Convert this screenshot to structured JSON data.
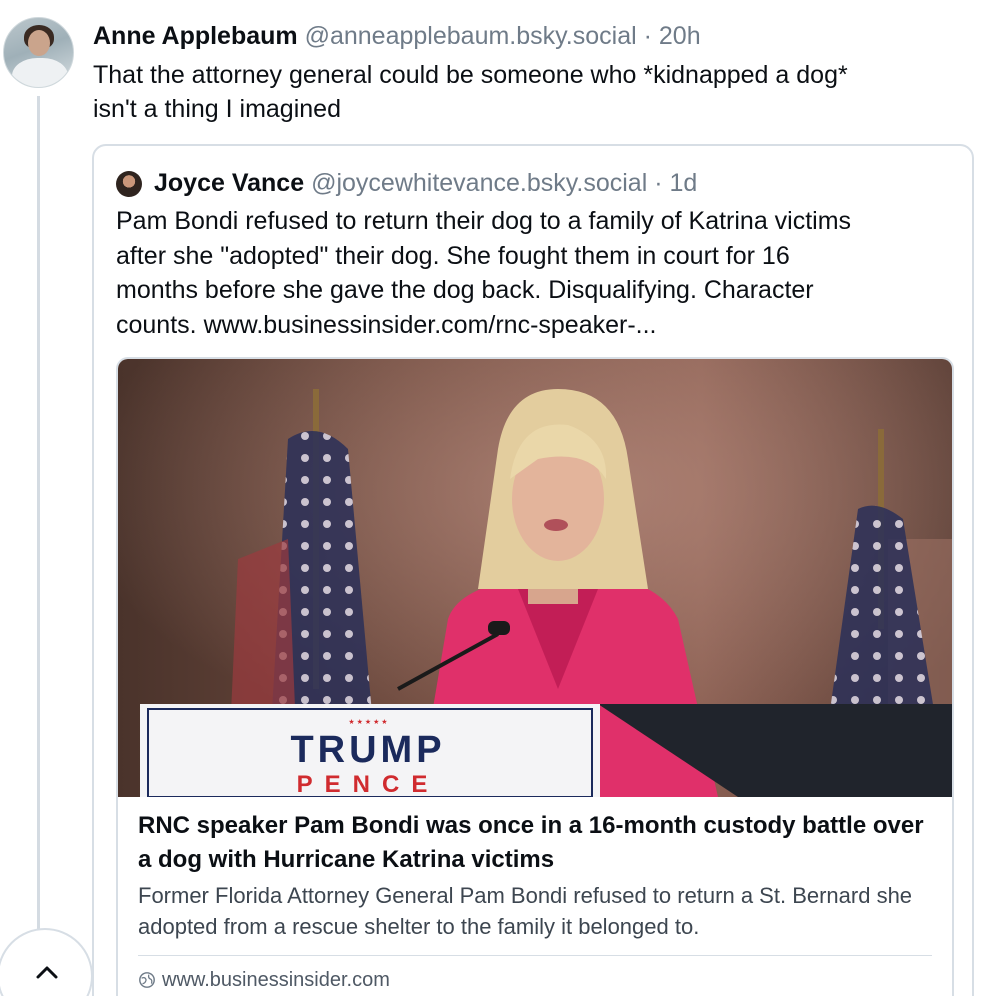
{
  "post": {
    "author": "Anne Applebaum",
    "handle": "@anneapplebaum.bsky.social",
    "separator": "·",
    "time": "20h",
    "text": "That the attorney general could be someone who *kidnapped a dog*\nisn't a thing I imagined"
  },
  "quote": {
    "author": "Joyce Vance",
    "handle": "@joycewhitevance.bsky.social",
    "separator": "·",
    "time": "1d",
    "text": "Pam Bondi refused to return their dog to a family of Katrina victims\nafter she \"adopted\" their dog. She fought them in court for 16\nmonths before she gave the dog back. Disqualifying. Character\ncounts.   ",
    "link_text": "www.businessinsider.com/rnc-speaker-..."
  },
  "embed": {
    "podium_line1": "TRUMP",
    "podium_line2": "PENCE",
    "podium_stars": "★ ★ ★ ★ ★",
    "title": "RNC speaker Pam Bondi was once in a 16-month custody battle over a dog with Hurricane Katrina victims",
    "description": "Former Florida Attorney General Pam Bondi refused to return a St. Bernard she adopted from a rescue shelter to the family it belonged to.",
    "domain": "www.businessinsider.com"
  },
  "icons": {
    "globe": "globe-icon",
    "scroll_top": "chevron-up-icon"
  },
  "colors": {
    "text": "#0b0f14",
    "muted": "#6f7b88",
    "border": "#d7dee5",
    "jacket": "#e0306a",
    "podium_blue": "#1b2a5c",
    "podium_red": "#d02b2f"
  }
}
